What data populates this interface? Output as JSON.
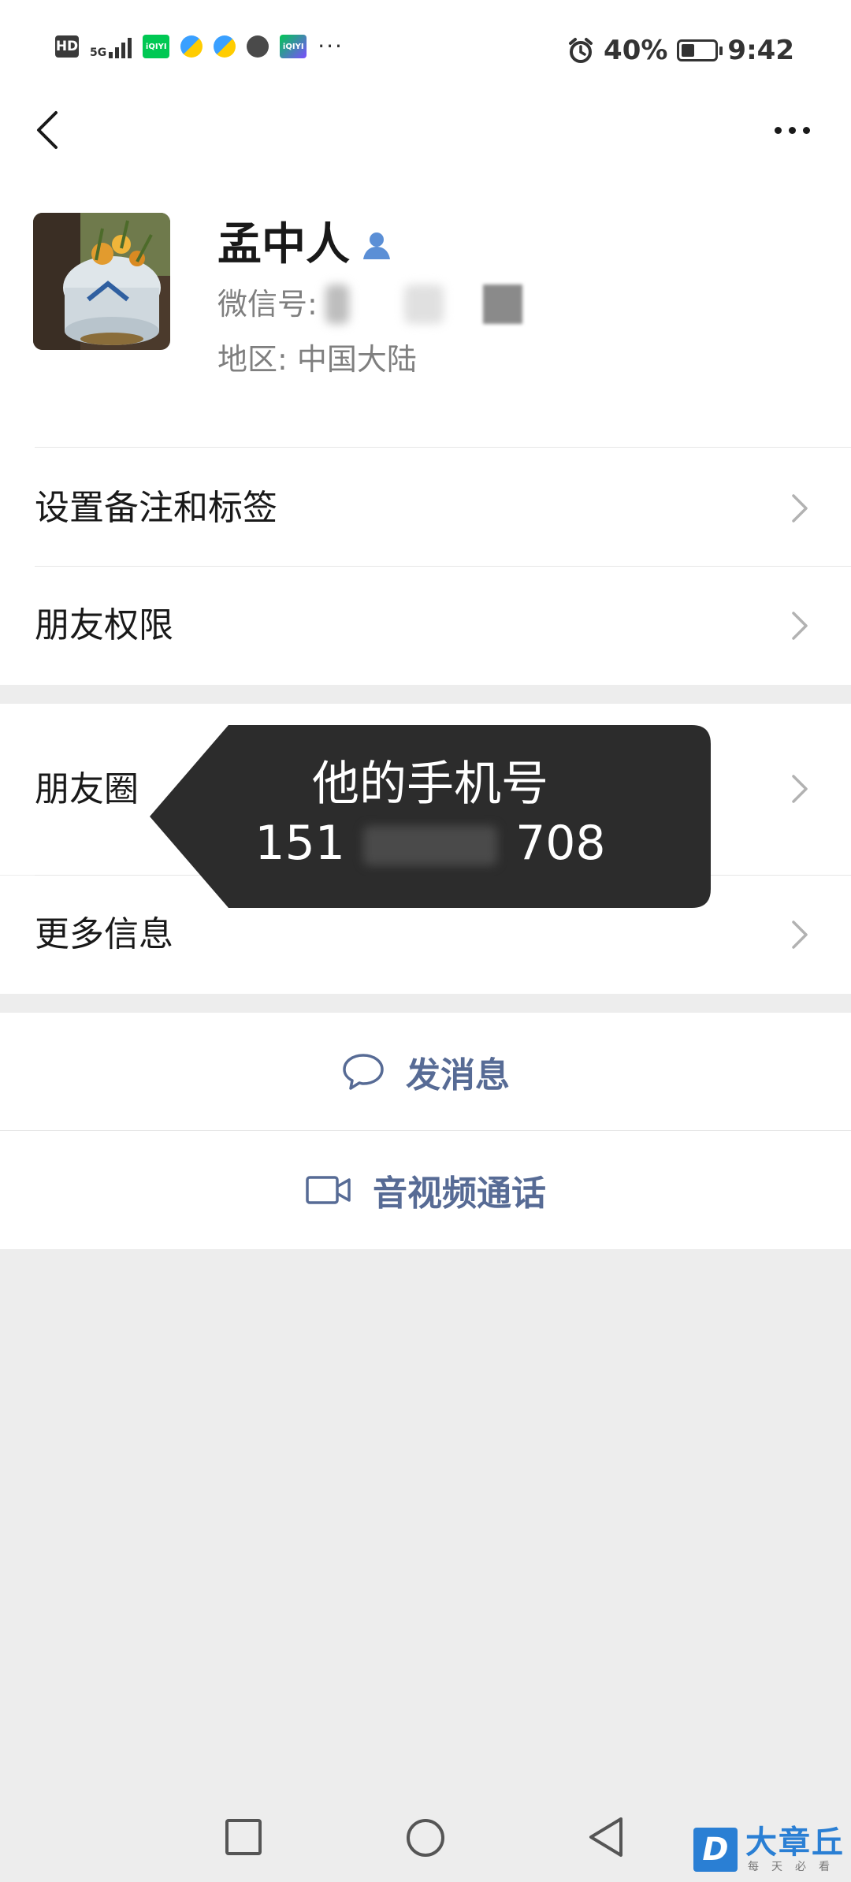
{
  "status_bar": {
    "hd": "HD",
    "network": "5G",
    "apps": [
      "iQIYI",
      "iQIYI"
    ],
    "more": "···",
    "battery_percent": "40%",
    "battery_level": 0.4,
    "time": "9:42"
  },
  "profile": {
    "name": "孟中人",
    "wechat_id_label": "微信号:",
    "region": "地区: 中国大陆"
  },
  "menu": {
    "remark_tags": "设置备注和标签",
    "friend_permissions": "朋友权限",
    "moments": "朋友圈",
    "more_info": "更多信息"
  },
  "actions": {
    "send_message": "发消息",
    "video_call": "音视频通话"
  },
  "tooltip": {
    "title": "他的手机号",
    "number": "151",
    "number_end": "708"
  },
  "watermark": {
    "logo": "D",
    "name": "大章丘",
    "sub": "每天必看"
  },
  "colors": {
    "link": "#576b95",
    "background": "#ededed",
    "tooltip": "#2c2c2c",
    "watermark": "#2a7fd4"
  }
}
